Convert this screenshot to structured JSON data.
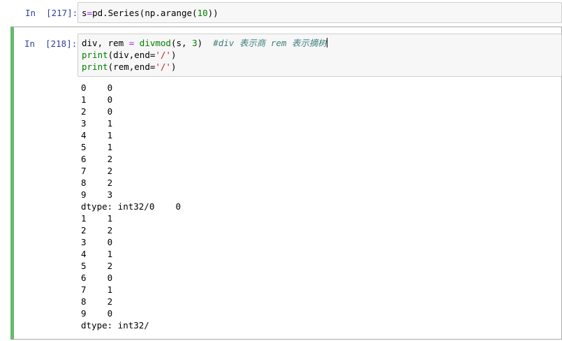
{
  "cells": [
    {
      "prompt": "In  [217]:",
      "code": {
        "var": "s",
        "op": "=",
        "call": "pd.Series(np.arange(",
        "arg": "10",
        "close": "))"
      }
    },
    {
      "prompt": "In  [218]:",
      "code_lines": {
        "line1": {
          "pre": "div, rem ",
          "op": "=",
          "fn": " divmod",
          "args": "(s, ",
          "num": "3",
          "close": ")  ",
          "comment": "#div 表示商 rem 表示摘树"
        },
        "line2": {
          "fn": "print",
          "open": "(div,end=",
          "str": "'/'",
          "close": ")"
        },
        "line3": {
          "fn": "print",
          "open": "(rem,end=",
          "str": "'/'",
          "close": ")"
        }
      },
      "output_lines": [
        "0    0",
        "1    0",
        "2    0",
        "3    1",
        "4    1",
        "5    1",
        "6    2",
        "7    2",
        "8    2",
        "9    3",
        "dtype: int32/0    0",
        "1    1",
        "2    2",
        "3    0",
        "4    1",
        "5    2",
        "6    0",
        "7    1",
        "8    2",
        "9    0",
        "dtype: int32/"
      ]
    }
  ],
  "colors": {
    "prompt": "#303f9f",
    "selected_cell_bar": "#66bb6a",
    "input_bg": "#f7f7f7",
    "builtin": "#008000",
    "operator": "#aa22ff",
    "string": "#ba2121",
    "comment": "#408080"
  }
}
